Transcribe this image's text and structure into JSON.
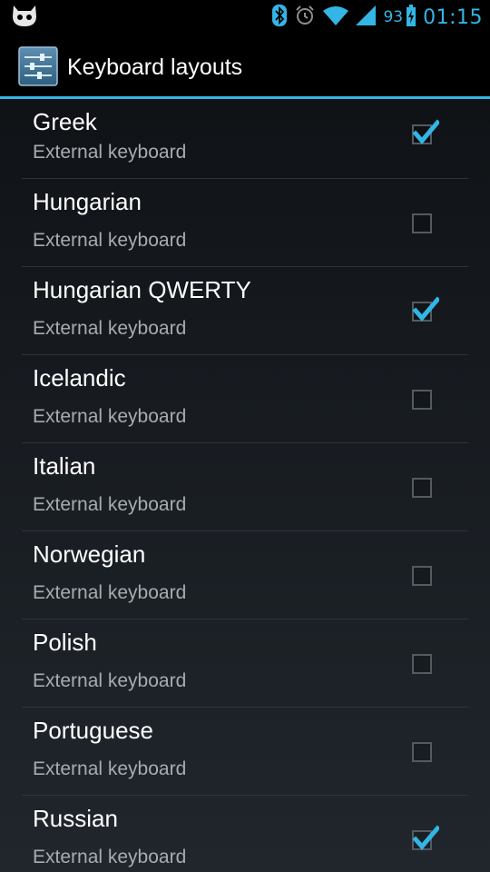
{
  "status_bar": {
    "battery_level": "93",
    "time": "01:15",
    "icons": [
      "cyanogen-mascot-icon",
      "bluetooth-icon",
      "alarm-icon",
      "wifi-icon",
      "signal-icon",
      "battery-charging-icon"
    ],
    "accent_color": "#33b5e5"
  },
  "action_bar": {
    "title": "Keyboard layouts",
    "icon": "settings-sliders-icon"
  },
  "layouts": [
    {
      "name": "Greek",
      "subtitle": "External keyboard",
      "checked": true
    },
    {
      "name": "Hungarian",
      "subtitle": "External keyboard",
      "checked": false
    },
    {
      "name": "Hungarian QWERTY",
      "subtitle": "External keyboard",
      "checked": true
    },
    {
      "name": "Icelandic",
      "subtitle": "External keyboard",
      "checked": false
    },
    {
      "name": "Italian",
      "subtitle": "External keyboard",
      "checked": false
    },
    {
      "name": "Norwegian",
      "subtitle": "External keyboard",
      "checked": false
    },
    {
      "name": "Polish",
      "subtitle": "External keyboard",
      "checked": false
    },
    {
      "name": "Portuguese",
      "subtitle": "External keyboard",
      "checked": false
    },
    {
      "name": "Russian",
      "subtitle": "External keyboard",
      "checked": true
    }
  ]
}
